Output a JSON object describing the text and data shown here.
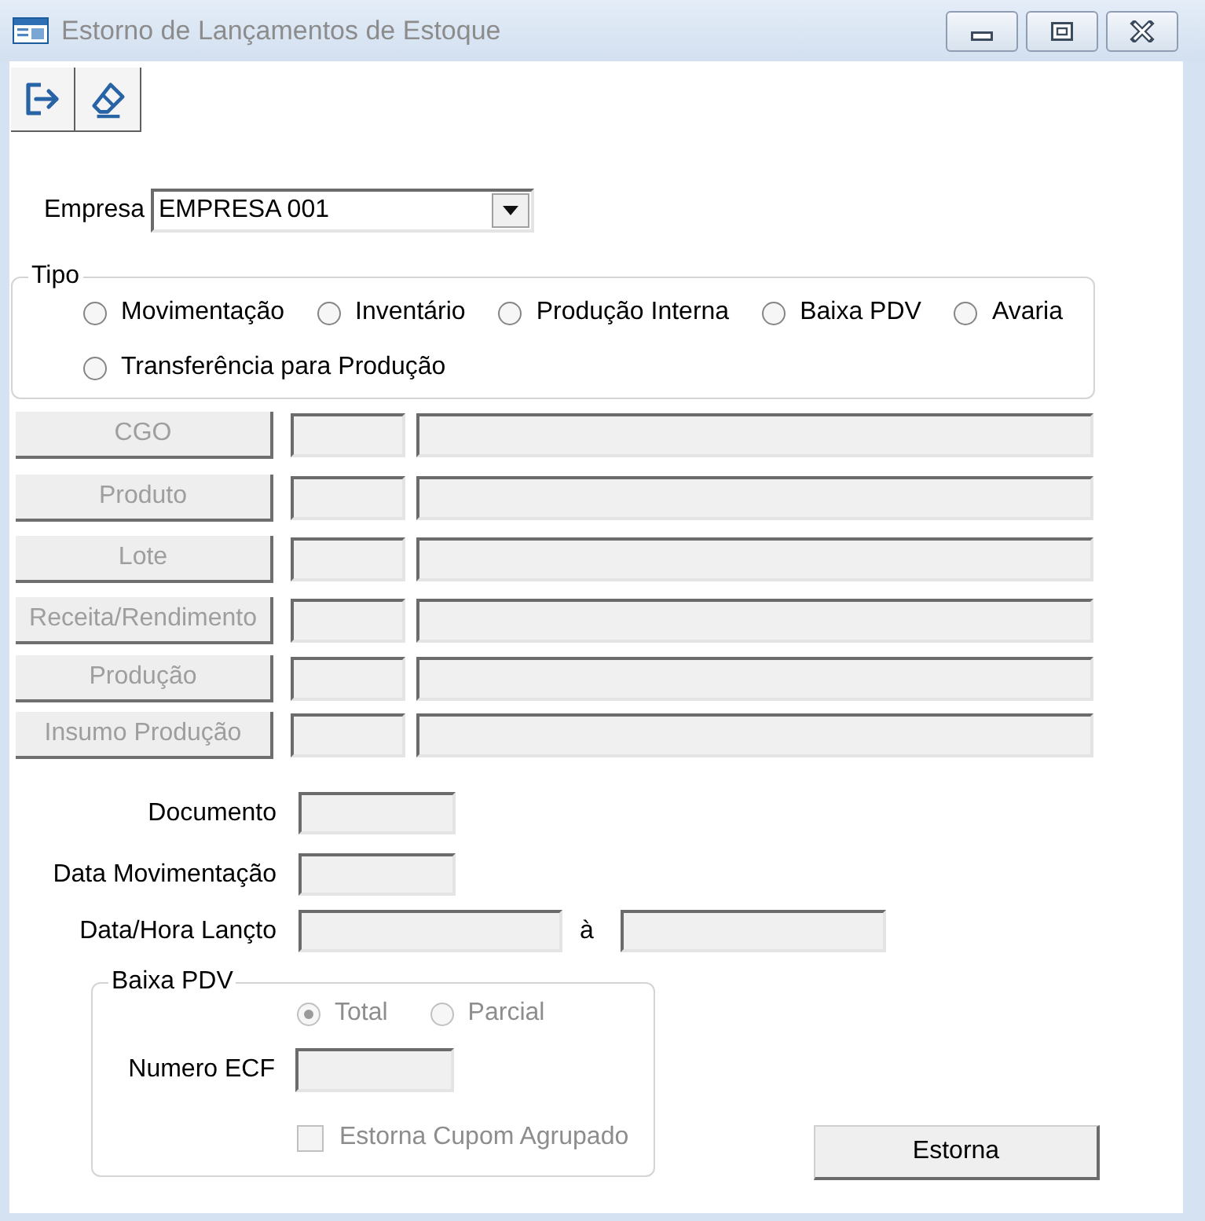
{
  "window": {
    "title": "Estorno de Lançamentos de Estoque"
  },
  "empresa": {
    "label": "Empresa",
    "value": "EMPRESA 001"
  },
  "tipo": {
    "title": "Tipo",
    "options": [
      {
        "label": "Movimentação",
        "selected": false
      },
      {
        "label": "Inventário",
        "selected": false
      },
      {
        "label": "Produção Interna",
        "selected": false
      },
      {
        "label": "Baixa PDV",
        "selected": false
      },
      {
        "label": "Avaria",
        "selected": false
      },
      {
        "label": "Transferência para Produção",
        "selected": false
      }
    ]
  },
  "lookups": [
    {
      "button": "CGO",
      "disabled": true
    },
    {
      "button": "Produto",
      "disabled": true
    },
    {
      "button": "Lote",
      "disabled": true
    },
    {
      "button": "Receita/Rendimento",
      "disabled": true
    },
    {
      "button": "Produção",
      "disabled": true
    },
    {
      "button": "Insumo Produção",
      "disabled": true
    }
  ],
  "fields": [
    {
      "label": "Documento",
      "kind": "single",
      "disabled": true
    },
    {
      "label": "Data Movimentação",
      "kind": "single",
      "disabled": true
    },
    {
      "label": "Data/Hora Lançto",
      "kind": "range",
      "separator": "à",
      "disabled": true
    }
  ],
  "baixa_pdv": {
    "title": "Baixa PDV",
    "disabled": true,
    "options": [
      {
        "label": "Total",
        "selected": true
      },
      {
        "label": "Parcial",
        "selected": false
      }
    ],
    "numero_ecf": {
      "label": "Numero ECF"
    },
    "agrupado": {
      "label": "Estorna Cupom Agrupado",
      "checked": false
    }
  },
  "action_button": {
    "label": "Estorna"
  }
}
